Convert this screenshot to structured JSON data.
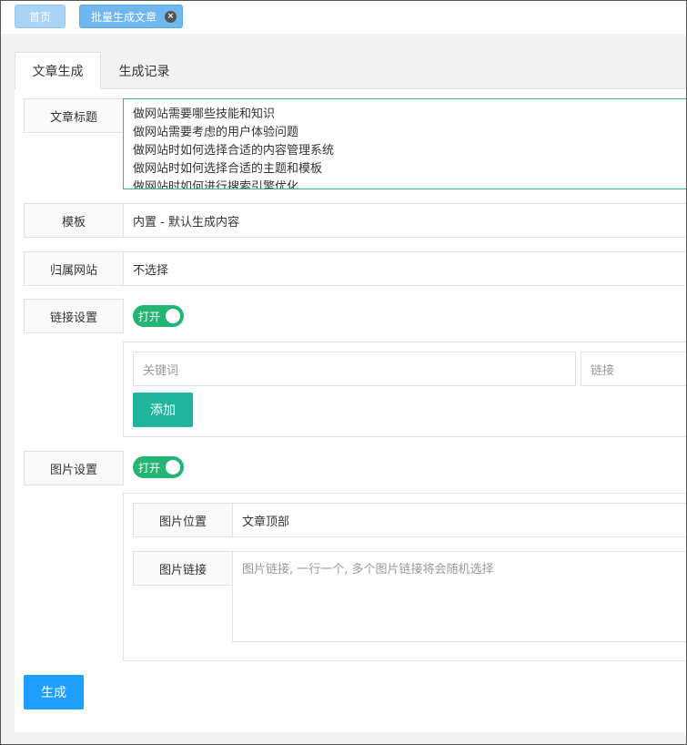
{
  "top_tabs": {
    "home": "首页",
    "active": "批量生成文章",
    "close": "×"
  },
  "inner_tabs": {
    "generate": "文章生成",
    "records": "生成记录"
  },
  "form": {
    "title_label": "文章标题",
    "titles": [
      "做网站需要哪些技能和知识",
      "做网站需要考虑的用户体验问题",
      "做网站时如何选择合适的内容管理系统",
      "做网站时如何选择合适的主题和模板",
      "做网站时如何进行搜索引擎优化"
    ],
    "template_label": "模板",
    "template_value": "内置 - 默认生成内容",
    "site_label": "归属网站",
    "site_value": "不选择",
    "link_label": "链接设置",
    "link_switch": "打开",
    "keyword_placeholder": "关键词",
    "link_placeholder": "链接",
    "add_button": "添加",
    "image_label": "图片设置",
    "image_switch": "打开",
    "image_position_label": "图片位置",
    "image_position_value": "文章顶部",
    "image_link_label": "图片链接",
    "image_link_placeholder": "图片链接, 一行一个, 多个图片链接将会随机选择",
    "generate_button": "生成"
  },
  "colors": {
    "primary": "#1e9fff",
    "green": "#20b59c",
    "switch_on": "#22b573",
    "focus_border": "#3bb58f"
  }
}
